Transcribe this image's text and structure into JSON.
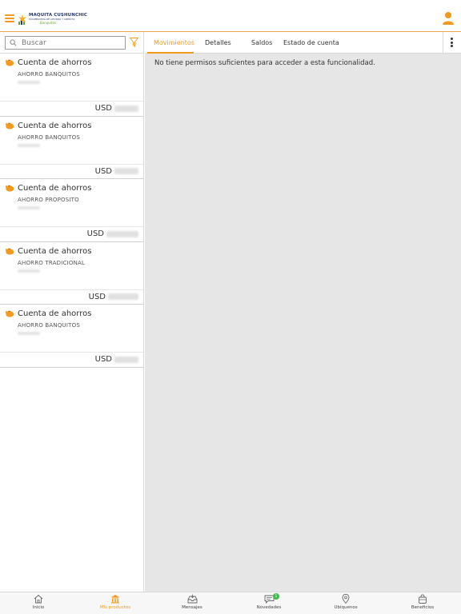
{
  "header": {
    "logo": {
      "name": "MAQUITA CUSHUNCHIC",
      "subtitle": "COOPERATIVA DE AHORRO Y CRÉDITO",
      "tagline": "Banquitos"
    }
  },
  "search": {
    "placeholder": "Buscar",
    "value": ""
  },
  "accounts": [
    {
      "title": "Cuenta de ahorros",
      "type": "AHORRO BANQUITOS",
      "currency": "USD"
    },
    {
      "title": "Cuenta de ahorros",
      "type": "AHORRO BANQUITOS",
      "currency": "USD"
    },
    {
      "title": "Cuenta de ahorros",
      "type": "AHORRO PROPOSITO",
      "currency": "USD"
    },
    {
      "title": "Cuenta de ahorros",
      "type": "AHORRO TRADICIONAL",
      "currency": "USD"
    },
    {
      "title": "Cuenta de ahorros",
      "type": "AHORRO BANQUITOS",
      "currency": "USD"
    }
  ],
  "tabs": [
    {
      "label": "Movimientos",
      "active": true
    },
    {
      "label": "Detalles",
      "active": false
    },
    {
      "label": "Saldos",
      "active": false
    },
    {
      "label": "Estado de cuenta",
      "active": false
    }
  ],
  "content": {
    "message": "No tiene permisos suficientes para acceder a esta funcionalidad."
  },
  "bottom_nav": [
    {
      "label": "Inicio",
      "icon": "home-icon",
      "active": false
    },
    {
      "label": "Mis productos",
      "icon": "bank-icon",
      "active": true
    },
    {
      "label": "Mensajes",
      "icon": "inbox-icon",
      "active": false
    },
    {
      "label": "Novedades",
      "icon": "chat-icon",
      "active": false,
      "badge": "1"
    },
    {
      "label": "Ubíquenos",
      "icon": "location-pin-icon",
      "active": false
    },
    {
      "label": "Beneficios",
      "icon": "bag-icon",
      "active": false
    }
  ],
  "colors": {
    "accent": "#f39a1e",
    "content_bg": "#e6e6e6",
    "badge": "#3dbb4c"
  }
}
